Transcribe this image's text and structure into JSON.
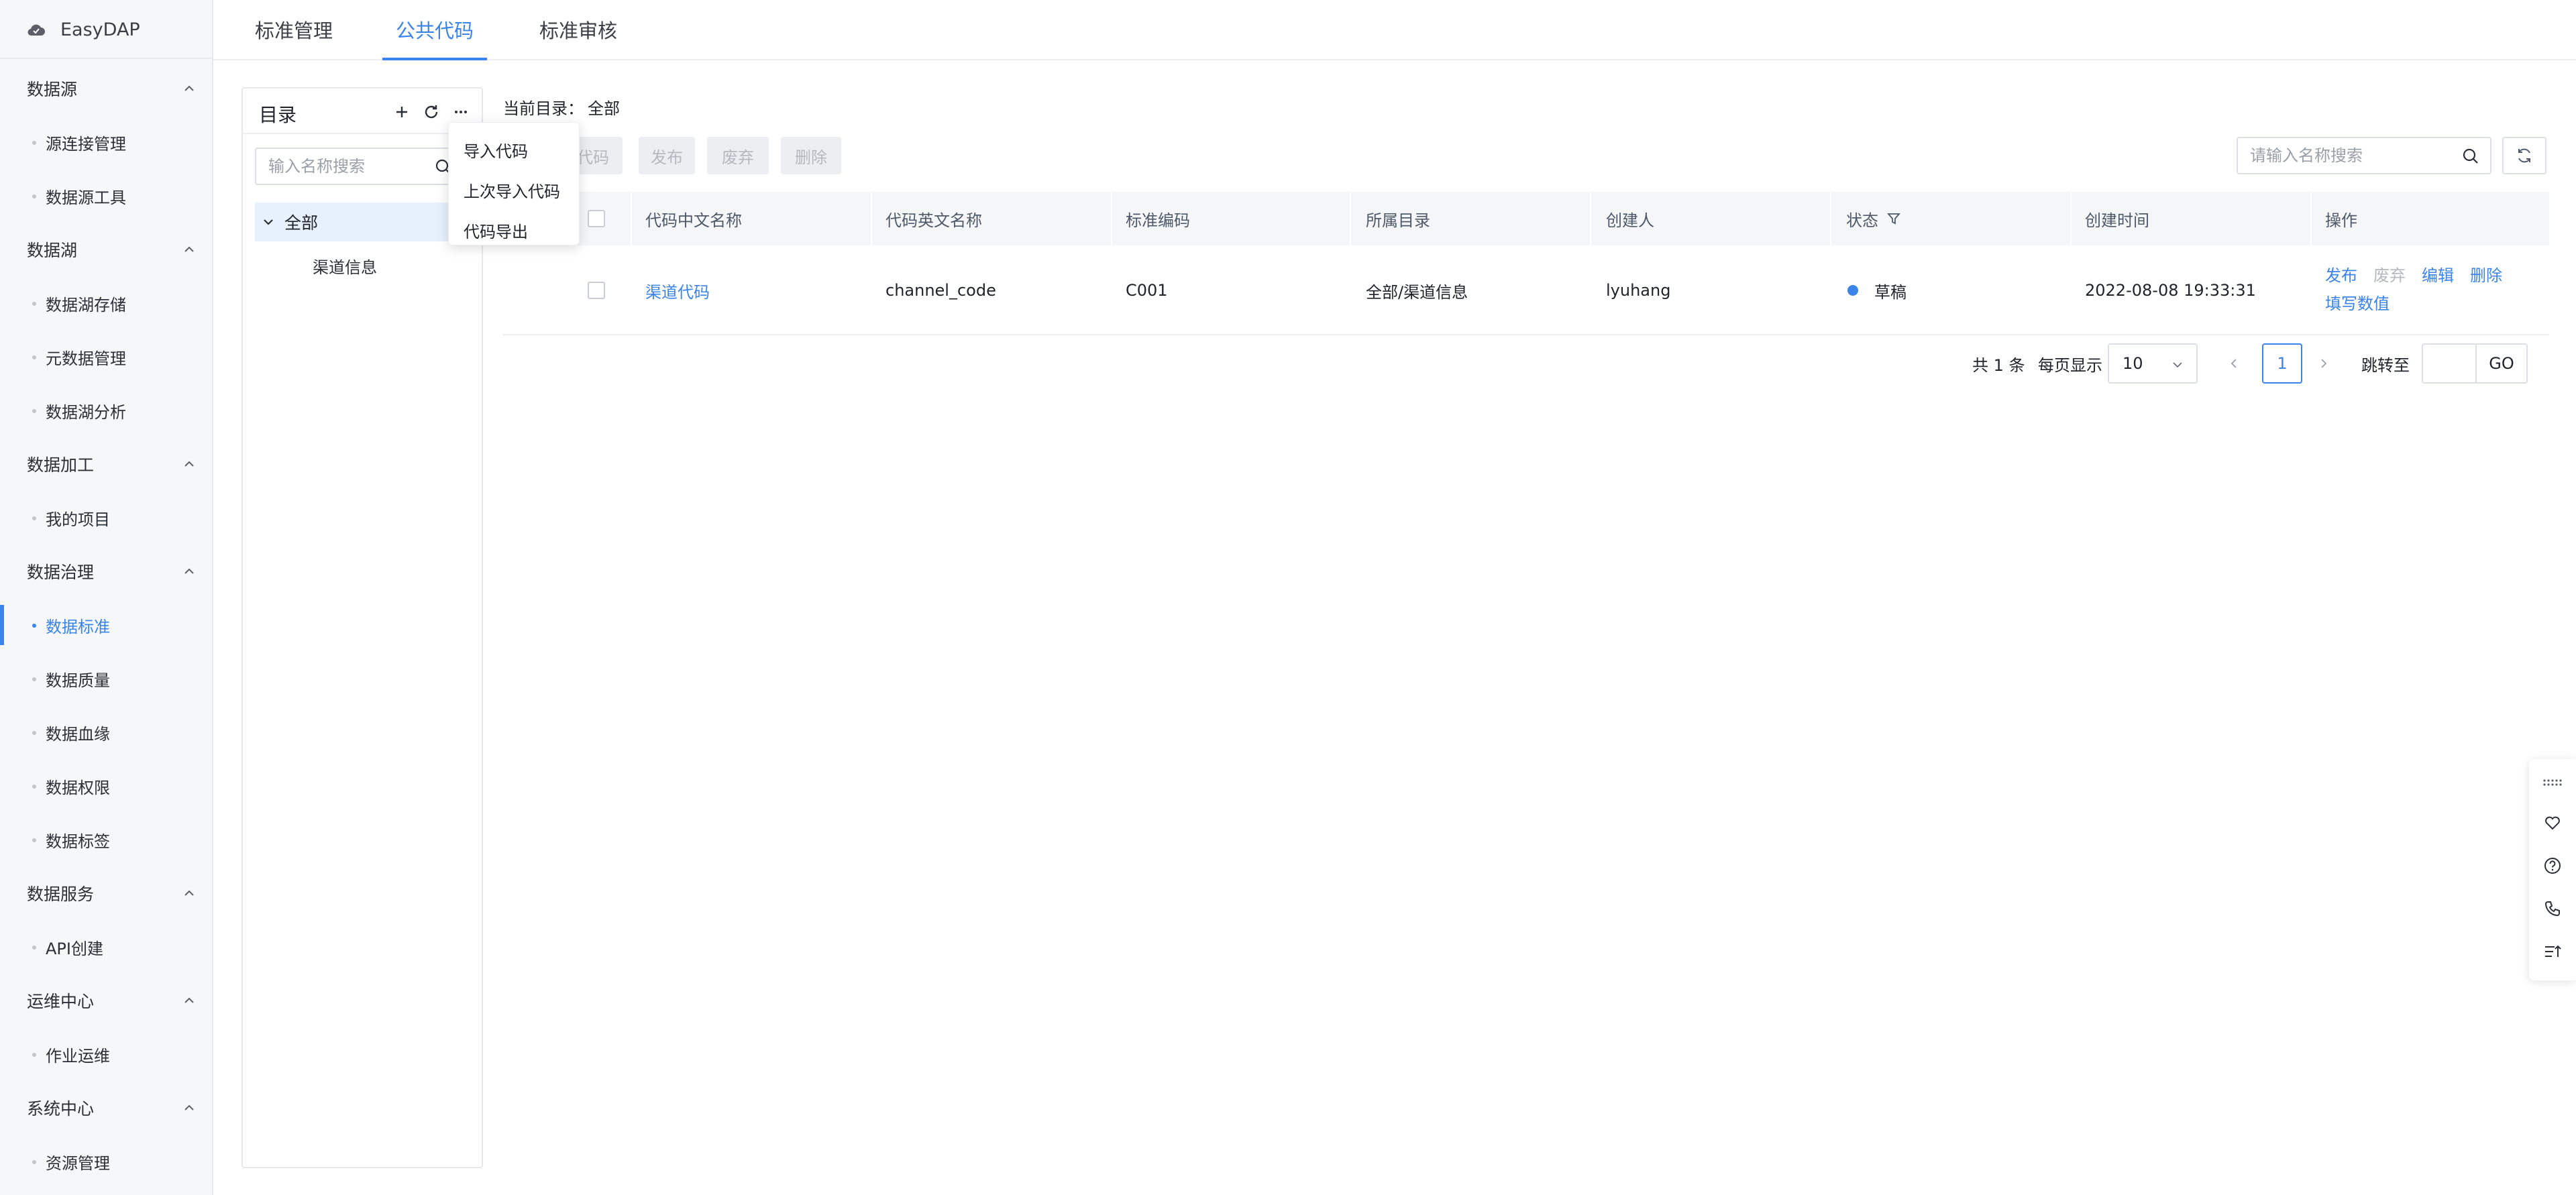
{
  "app": {
    "name": "EasyDAP"
  },
  "sidebar": {
    "groups": [
      {
        "label": "数据源",
        "items": [
          "源连接管理",
          "数据源工具"
        ]
      },
      {
        "label": "数据湖",
        "items": [
          "数据湖存储",
          "元数据管理",
          "数据湖分析"
        ]
      },
      {
        "label": "数据加工",
        "items": [
          "我的项目"
        ]
      },
      {
        "label": "数据治理",
        "items": [
          "数据标准",
          "数据质量",
          "数据血缘",
          "数据权限",
          "数据标签"
        ]
      },
      {
        "label": "数据服务",
        "items": [
          "API创建"
        ]
      },
      {
        "label": "运维中心",
        "items": [
          "作业运维"
        ]
      },
      {
        "label": "系统中心",
        "items": [
          "资源管理"
        ]
      }
    ],
    "active_item": "数据标准"
  },
  "tabs": [
    {
      "label": "标准管理",
      "active": false
    },
    {
      "label": "公共代码",
      "active": true
    },
    {
      "label": "标准审核",
      "active": false
    }
  ],
  "catalog": {
    "title": "目录",
    "search_placeholder": "输入名称搜索",
    "tree": {
      "root": "全部",
      "children": [
        "渠道信息"
      ]
    },
    "menu": [
      "导入代码",
      "上次导入代码",
      "代码导出"
    ]
  },
  "main": {
    "current_dir_label": "当前目录：",
    "current_dir_value": "全部",
    "toolbar": {
      "new_partial": "代码",
      "publish": "发布",
      "discard": "废弃",
      "delete": "删除"
    },
    "search_placeholder": "请输入名称搜索"
  },
  "table": {
    "columns": [
      "代码中文名称",
      "代码英文名称",
      "标准编码",
      "所属目录",
      "创建人",
      "状态",
      "创建时间",
      "操作"
    ],
    "rows": [
      {
        "cn_name": "渠道代码",
        "en_name": "channel_code",
        "code": "C001",
        "directory": "全部/渠道信息",
        "creator": "lyuhang",
        "status": "草稿",
        "created": "2022-08-08 19:33:31",
        "ops": {
          "publish": "发布",
          "discard": "废弃",
          "edit": "编辑",
          "delete": "删除",
          "fill": "填写数值"
        }
      }
    ]
  },
  "pagination": {
    "total_text": "共 1 条",
    "per_page_label": "每页显示",
    "per_page_value": "10",
    "current_page": "1",
    "jump_label": "跳转至",
    "go_label": "GO"
  },
  "colors": {
    "accent": "#3a84ea",
    "sidebar_bg": "#f6f7f9",
    "header_bg": "#f5f6f8"
  }
}
